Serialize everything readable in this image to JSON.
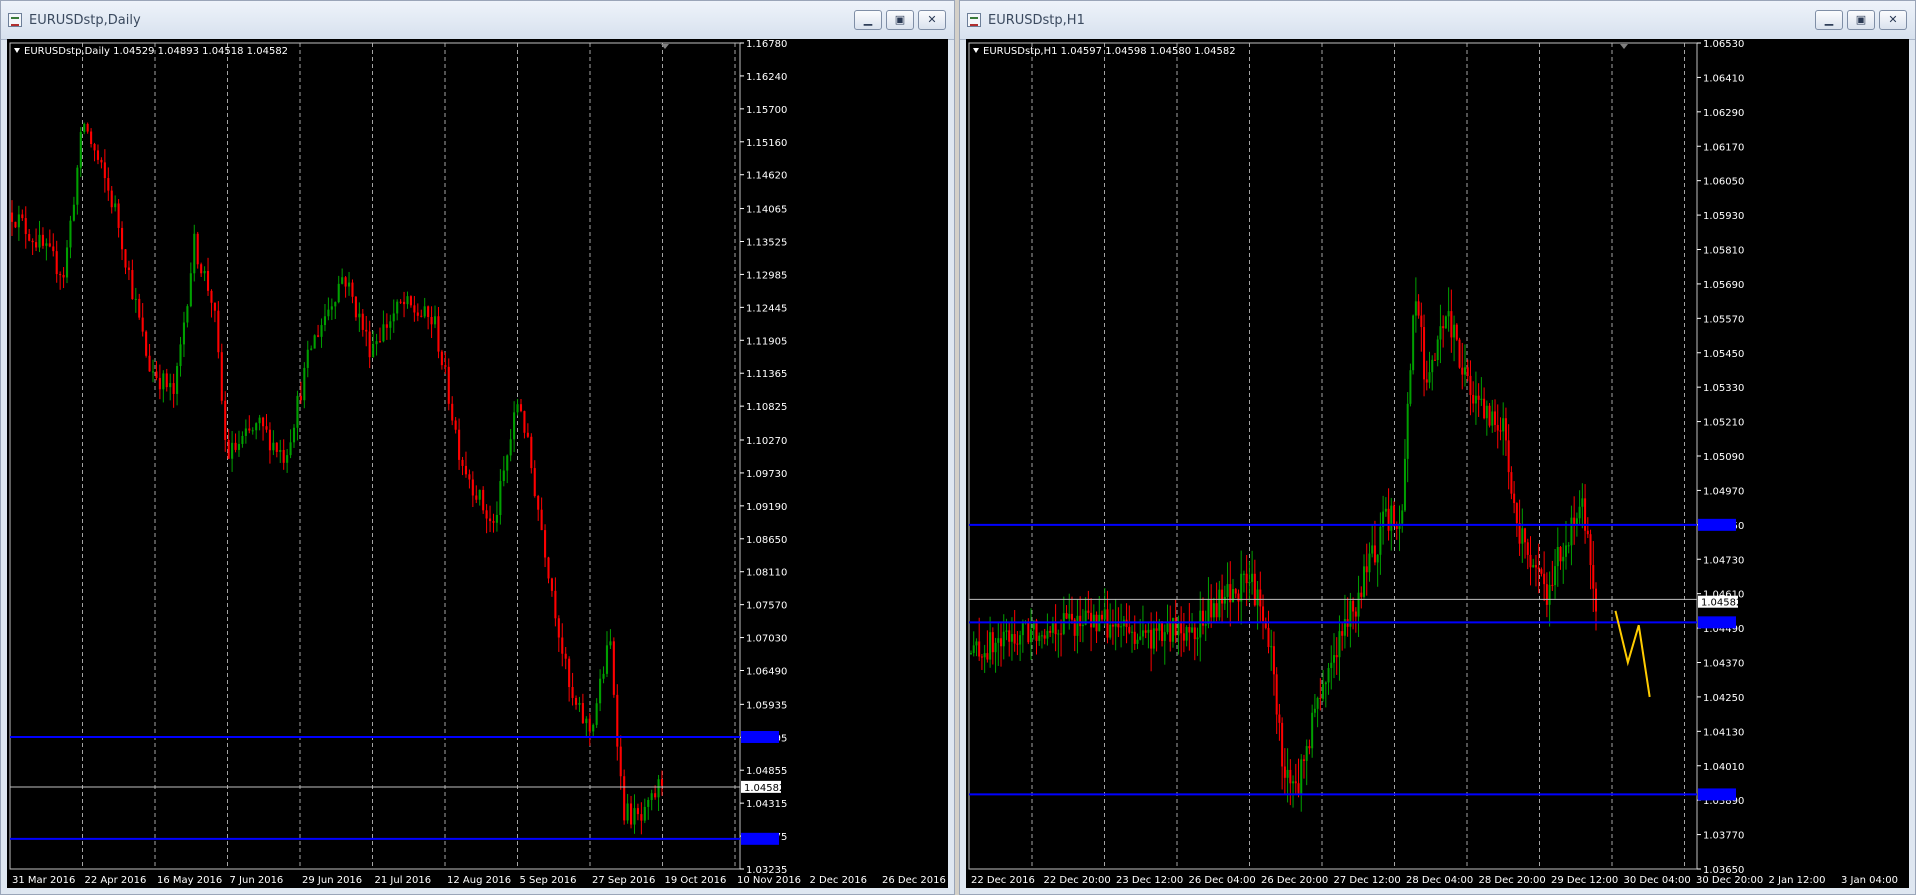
{
  "windows": [
    {
      "title": "EURUSDstp,Daily",
      "symbol_line": "EURUSDstp,Daily  1.04529 1.04893 1.04518 1.04582",
      "current_price": "1.04582",
      "price_labels": [
        "1.16780",
        "1.16240",
        "1.15700",
        "1.15160",
        "1.14620",
        "1.14065",
        "1.13525",
        "1.12985",
        "1.12445",
        "1.11905",
        "1.11365",
        "1.10825",
        "1.10270",
        "1.09730",
        "1.09190",
        "1.08650",
        "1.08110",
        "1.07570",
        "1.07030",
        "1.06490",
        "1.05935",
        "1.05395",
        "1.04855",
        "1.04315",
        "1.03775",
        "1.03235"
      ],
      "time_labels": [
        "31 Mar 2016",
        "22 Apr 2016",
        "16 May 2016",
        "7 Jun 2016",
        "29 Jun 2016",
        "21 Jul 2016",
        "12 Aug 2016",
        "5 Sep 2016",
        "27 Sep 2016",
        "19 Oct 2016",
        "10 Nov 2016",
        "2 Dec 2016",
        "26 Dec 2016"
      ],
      "horizontal_lines": [
        {
          "price": 1.054,
          "color": "#0000ff"
        },
        {
          "price": 1.0458,
          "color": "#c0c0c0"
        },
        {
          "price": 1.0373,
          "color": "#0000ff"
        }
      ],
      "price_range": [
        1.03235,
        1.1678
      ]
    },
    {
      "title": "EURUSDstp,H1",
      "symbol_line": "EURUSDstp,H1  1.04597 1.04598 1.04580 1.04582",
      "current_price": "1.04582",
      "price_labels": [
        "1.06530",
        "1.06410",
        "1.06290",
        "1.06170",
        "1.06050",
        "1.05930",
        "1.05810",
        "1.05690",
        "1.05570",
        "1.05450",
        "1.05330",
        "1.05210",
        "1.05090",
        "1.04970",
        "1.04850",
        "1.04730",
        "1.04610",
        "1.04490",
        "1.04370",
        "1.04250",
        "1.04130",
        "1.04010",
        "1.03890",
        "1.03770",
        "1.03650"
      ],
      "time_labels": [
        "22 Dec 2016",
        "22 Dec 20:00",
        "23 Dec 12:00",
        "26 Dec 04:00",
        "26 Dec 20:00",
        "27 Dec 12:00",
        "28 Dec 04:00",
        "28 Dec 20:00",
        "29 Dec 12:00",
        "30 Dec 04:00",
        "30 Dec 20:00",
        "2 Jan 12:00",
        "3 Jan 04:00"
      ],
      "horizontal_lines": [
        {
          "price": 1.0485,
          "color": "#0000ff"
        },
        {
          "price": 1.0459,
          "color": "#c0c0c0"
        },
        {
          "price": 1.0451,
          "color": "#0000ff"
        },
        {
          "price": 1.0391,
          "color": "#0000ff"
        }
      ],
      "price_range": [
        1.0365,
        1.0653
      ]
    }
  ],
  "colors": {
    "bull": "#00a000",
    "bear": "#ff0000",
    "grid": "#c0c0c0",
    "projection": "#ffcc00",
    "background": "#000000"
  }
}
